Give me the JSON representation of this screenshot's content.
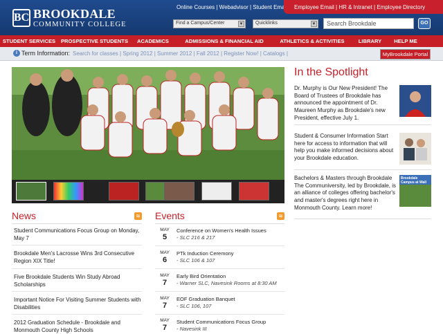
{
  "header": {
    "logo_mark": "BC",
    "logo_name": "BROOKDALE",
    "logo_sub": "COMMUNITY COLLEGE",
    "top_links": [
      "Online Courses",
      "Webadvisor",
      "Student Email"
    ],
    "red_links": [
      "Employee Email",
      "HR & Intranet",
      "Employee Directory"
    ],
    "select_campus": "Find a Campus/Center",
    "select_quicklinks": "Quicklinks",
    "search_placeholder": "Search Brookdale",
    "go_label": "GO"
  },
  "nav": [
    "STUDENT SERVICES",
    "PROSPECTIVE STUDENTS",
    "ACADEMICS",
    "ADMISSIONS & FINANCIAL AID",
    "ATHLETICS & ACTIVITIES",
    "LIBRARY",
    "HELP ME"
  ],
  "term": {
    "label": "Term Information:",
    "links": [
      "Search for classes",
      "Spring 2012",
      "Summer 2012",
      "Fall 2012",
      "Register Now!",
      "Catalogs"
    ],
    "portal": "MyBrookdale Portal"
  },
  "spotlight": {
    "title": "In the Spotlight",
    "items": [
      {
        "text": "Dr. Murphy is Our New President! The Board of Trustees of Brookdale has announced the appointment of Dr. Maureen Murphy as Brookdale's new President, effective July 1."
      },
      {
        "text": "Student & Consumer Information Start here for access to information that will help you make informed decisions about your Brookdale education."
      },
      {
        "text": "Bachelors & Masters through Brookdale The Communiversity, led by Brookdale, is an alliance of colleges offering bachelor's and master's degrees right here in Monmouth County. Learn more!",
        "img_caption": "Brookdale Campus at Wall"
      }
    ]
  },
  "news": {
    "title": "News",
    "items": [
      "Student Communications Focus Group on Monday, May 7",
      "Brookdale Men's Lacrosse Wins 3rd Consecutive Region XIX Title!",
      "Five Brookdale Students Win Study Abroad Scholarships",
      "Important Notice For Visiting Summer Students with Disabilities",
      "2012 Graduation Schedule - Brookdale and Monmouth County High Schools"
    ]
  },
  "events": {
    "title": "Events",
    "items": [
      {
        "month": "MAY",
        "day": "5",
        "title": "Conference on Women's Health Issues",
        "loc": "- SLC 216 & 217"
      },
      {
        "month": "MAY",
        "day": "6",
        "title": "PTk Induction Ceremony",
        "loc": "- SLC 106 & 107"
      },
      {
        "month": "MAY",
        "day": "7",
        "title": "Early Bird Orientation",
        "loc": "- Warner SLC, Navesink Rooms at 8:30 AM"
      },
      {
        "month": "MAY",
        "day": "7",
        "title": "EOF Graduation Banquet",
        "loc": "- SLC 106, 107"
      },
      {
        "month": "MAY",
        "day": "7",
        "title": "Student Communications Focus Group",
        "loc": "- Navesink III"
      }
    ]
  },
  "colors": {
    "brand_blue": "#1f4b8f",
    "brand_red": "#c61f27"
  }
}
